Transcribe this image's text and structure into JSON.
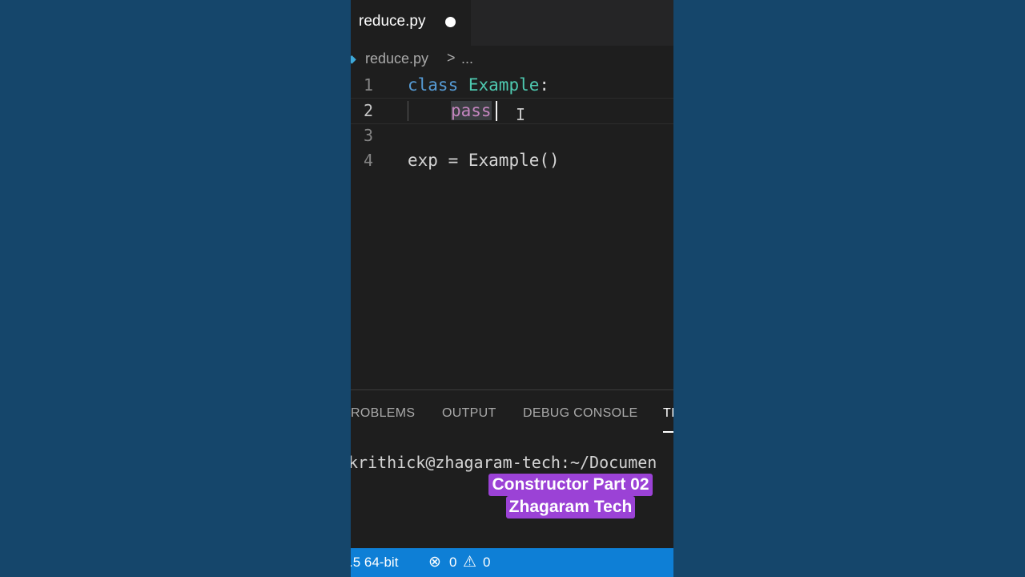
{
  "tab": {
    "filename": "reduce.py"
  },
  "breadcrumb": {
    "file": "reduce.py",
    "separator": ">",
    "more": "..."
  },
  "editor": {
    "lines": [
      {
        "number": "1",
        "keyword": "class",
        "name": "Example",
        "punct": ":"
      },
      {
        "number": "2",
        "keyword": "pass"
      },
      {
        "number": "3"
      },
      {
        "number": "4",
        "var": "exp",
        "op": " = ",
        "call": "Example()"
      }
    ]
  },
  "panel": {
    "tabs": [
      "ROBLEMS",
      "OUTPUT",
      "DEBUG CONSOLE",
      "TI"
    ],
    "active_tab": "TI",
    "terminal_prompt": "krithick@zhagaram-tech:~/Documen"
  },
  "overlay": {
    "line1": "Constructor Part 02",
    "line2": "Zhagaram Tech"
  },
  "statusbar": {
    "interpreter": ".5 64-bit",
    "errors": "0",
    "warnings": "0"
  },
  "colors": {
    "background": "#15466b",
    "editor_bg": "#1e1e1e",
    "statusbar": "#0e7fd6",
    "caption_bg": "#9b42d6",
    "keyword_blue": "#569cd6",
    "class_teal": "#4ec9b0",
    "control_pink": "#c586c0"
  },
  "icons": [
    "python-file-icon",
    "error-icon",
    "warning-icon",
    "text-cursor-icon"
  ]
}
